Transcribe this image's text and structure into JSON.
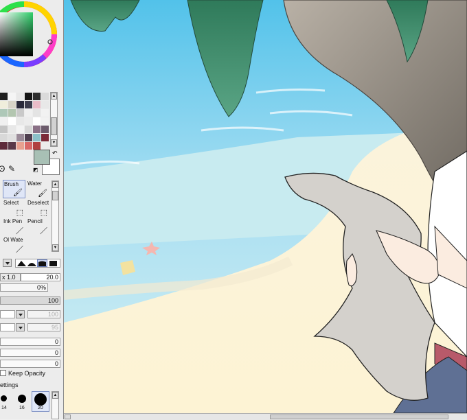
{
  "tools": {
    "brush": "Brush",
    "water": "Water",
    "select": "Select",
    "deselect": "Deselect",
    "ink_pen": "Ink Pen",
    "pencil": "Pencil",
    "oil_water": "Ol Wate"
  },
  "brush_settings": {
    "size_multiplier": "x 1.0",
    "size": "20.0",
    "min_size": "0%",
    "density": "100",
    "texture_strength": "100",
    "blending_strength": "95",
    "blending": "0",
    "dilution": "0",
    "persistence": "0",
    "keep_opacity_label": "Keep Opacity",
    "advanced_settings_label": "ettings"
  },
  "brush_sizes": [
    {
      "label": "14"
    },
    {
      "label": "16"
    },
    {
      "label": "20"
    }
  ],
  "colors": {
    "current_fg": "#a8c0b5",
    "current_bg": "#ffffff",
    "swatches": [
      "#1e1e1e",
      "#f5f5f5",
      "#e8e8e8",
      "#141414",
      "#2d2d2d",
      "#dadada",
      "#f0eedc",
      "#d8d4c8",
      "#2a2a3a",
      "#3d3d4d",
      "#e9bcc8",
      "#e8e8e8",
      "#aec8b8",
      "#b3c6b0",
      "#c9c9c9",
      "#f0f0f0",
      "#e4e4e4",
      "#f2f2f2",
      "#f0f0f0",
      "#ffffff",
      "#e8e8e8",
      "#ececec",
      "#ffffff",
      "#f2f2f2",
      "#c4c4c4",
      "#e8e8e8",
      "#f3f3f3",
      "#d7d7d7",
      "#8a7086",
      "#6c5b6c",
      "#d8d8d8",
      "#e0e0e0",
      "#9a8a98",
      "#4f3f4f",
      "#8bc0c8",
      "#7c2a38",
      "#5d2a3a",
      "#5a3848",
      "#e8a090",
      "#d86868",
      "#b04040"
    ]
  }
}
